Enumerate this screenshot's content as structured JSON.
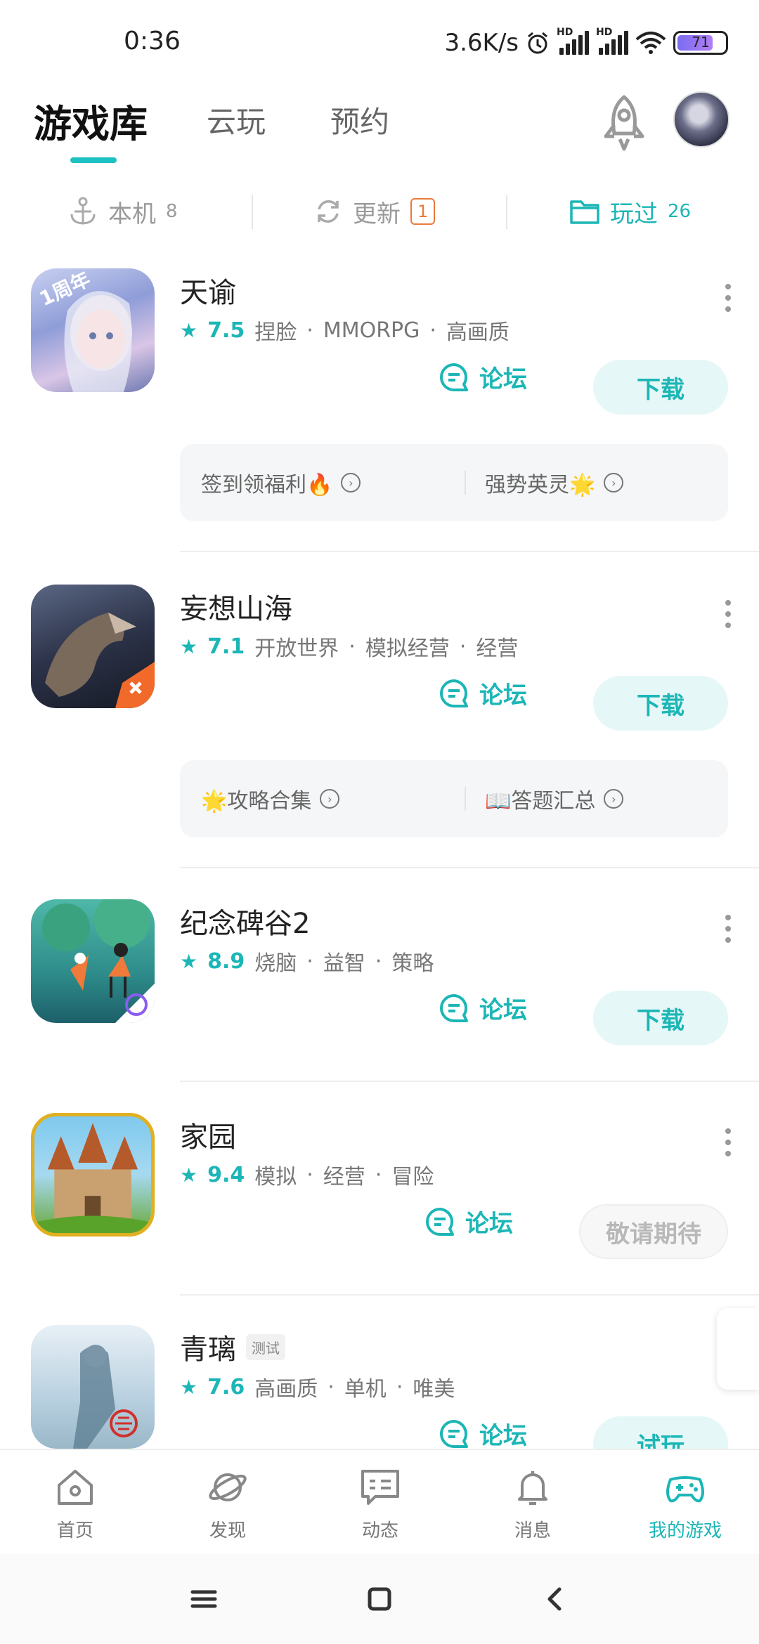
{
  "status": {
    "time": "0:36",
    "speed": "3.6K/s",
    "battery": "71"
  },
  "topnav": {
    "tabs": [
      "游戏库",
      "云玩",
      "预约"
    ]
  },
  "filters": {
    "local": {
      "label": "本机",
      "count": "8"
    },
    "update": {
      "label": "更新",
      "count": "1"
    },
    "played": {
      "label": "玩过",
      "count": "26"
    }
  },
  "games": [
    {
      "name": "天谕",
      "score": "7.5",
      "tags": [
        "捏脸",
        "MMORPG",
        "高画质"
      ],
      "forum": "论坛",
      "action": "下载",
      "promo": [
        "签到领福利🔥",
        "强势英灵🌟"
      ]
    },
    {
      "name": "妄想山海",
      "score": "7.1",
      "tags": [
        "开放世界",
        "模拟经营",
        "经营"
      ],
      "forum": "论坛",
      "action": "下载",
      "promo": [
        "🌟攻略合集",
        "📖答题汇总"
      ]
    },
    {
      "name": "纪念碑谷2",
      "score": "8.9",
      "tags": [
        "烧脑",
        "益智",
        "策略"
      ],
      "forum": "论坛",
      "action": "下载"
    },
    {
      "name": "家园",
      "score": "9.4",
      "tags": [
        "模拟",
        "经营",
        "冒险"
      ],
      "forum": "论坛",
      "action": "敬请期待"
    },
    {
      "name": "青璃",
      "badge": "测试",
      "score": "7.6",
      "tags": [
        "高画质",
        "单机",
        "唯美"
      ],
      "forum": "论坛",
      "action": "试玩"
    }
  ],
  "icon_label": "1周年",
  "bottomnav": {
    "items": [
      "首页",
      "发现",
      "动态",
      "消息",
      "我的游戏"
    ]
  },
  "colors": {
    "accent": "#1cb6b6",
    "badge": "#e97a3a"
  }
}
